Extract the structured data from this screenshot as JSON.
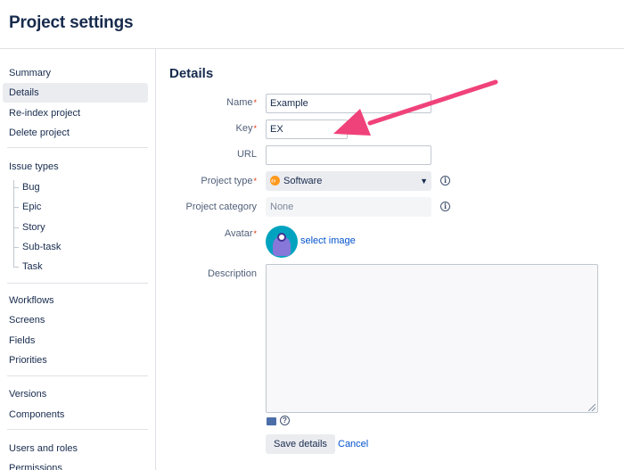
{
  "page": {
    "title": "Project settings"
  },
  "sidebar": {
    "top_items": [
      "Summary",
      "Details",
      "Re-index project",
      "Delete project"
    ],
    "issue_types_heading": "Issue types",
    "issue_types": [
      "Bug",
      "Epic",
      "Story",
      "Sub-task",
      "Task"
    ],
    "group_config": [
      "Workflows",
      "Screens",
      "Fields",
      "Priorities"
    ],
    "group_versions": [
      "Versions",
      "Components"
    ],
    "group_people": [
      "Users and roles",
      "Permissions"
    ],
    "selected": "Details"
  },
  "details": {
    "heading": "Details",
    "name": {
      "label": "Name",
      "value": "Example",
      "required": "*"
    },
    "key": {
      "label": "Key",
      "value": "EX",
      "required": "*"
    },
    "url": {
      "label": "URL",
      "value": ""
    },
    "project_type": {
      "label": "Project type",
      "value": "Software",
      "required": "*",
      "icon": "software-icon",
      "info": "i"
    },
    "project_category": {
      "label": "Project category",
      "value": "None",
      "info": "i"
    },
    "avatar": {
      "label": "Avatar",
      "required": "*",
      "link": "select image"
    },
    "description": {
      "label": "Description",
      "value": "",
      "help": "?"
    },
    "buttons": {
      "save": "Save details",
      "cancel": "Cancel"
    }
  },
  "annotation": {
    "arrow_color": "#f0427a"
  }
}
